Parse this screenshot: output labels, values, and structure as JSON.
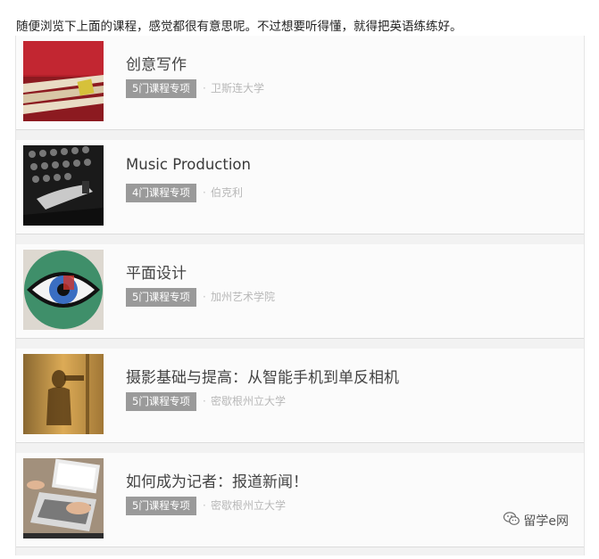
{
  "intro_text": "随便浏览下上面的课程，感觉都很有意思呢。不过想要听得懂，就得把英语练练好。",
  "courses": [
    {
      "title": "创意写作",
      "badge": "5门课程专项",
      "school": "卫斯连大学",
      "image": "stacked-books-image"
    },
    {
      "title": "Music Production",
      "badge": "4门课程专项",
      "school": "伯克利",
      "image": "mixing-console-image"
    },
    {
      "title": "平面设计",
      "badge": "5门课程专项",
      "school": "加州艺术学院",
      "image": "eye-illustration-image"
    },
    {
      "title": "摄影基础与提高：从智能手机到单反相机",
      "badge": "5门课程专项",
      "school": "密歇根州立大学",
      "image": "photographer-silhouette-image"
    },
    {
      "title": "如何成为记者：报道新闻！",
      "badge": "5门课程专项",
      "school": "密歇根州立大学",
      "image": "laptop-typing-image"
    }
  ],
  "separator": "·",
  "watermark": {
    "text": "留学e网",
    "icon": "wechat-icon"
  }
}
